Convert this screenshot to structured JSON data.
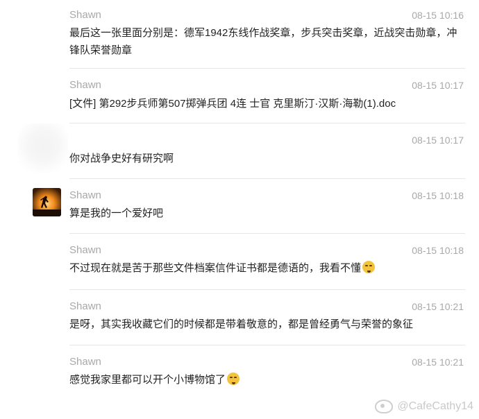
{
  "messages": [
    {
      "sender": "Shawn",
      "time": "08-15 10:16",
      "text": "最后这一张里面分别是：德军1942东线作战奖章，步兵突击奖章，近战突击勋章，冲锋队荣誉勋章"
    },
    {
      "sender": "Shawn",
      "time": "08-15 10:17",
      "text": "[文件] 第292步兵师第507掷弹兵团 4连 士官 克里斯汀·汉斯·海勒(1).doc"
    },
    {
      "sender": "",
      "time": "08-15 10:17",
      "text": "你对战争史好有研究啊"
    },
    {
      "sender": "Shawn",
      "time": "08-15 10:18",
      "text": "算是我的一个爱好吧"
    },
    {
      "sender": "Shawn",
      "time": "08-15 10:18",
      "text": "不过现在就是苦于那些文件档案信件证书都是德语的，我看不懂",
      "emoji": "crying-face-icon"
    },
    {
      "sender": "Shawn",
      "time": "08-15 10:21",
      "text": "是呀，其实我收藏它们的时候都是带着敬意的，都是曾经勇气与荣誉的象征"
    },
    {
      "sender": "Shawn",
      "time": "08-15 10:21",
      "text": "感觉我家里都可以开个小博物馆了",
      "emoji": "laughing-tears-icon"
    }
  ],
  "watermark": "@CafeCathy14"
}
